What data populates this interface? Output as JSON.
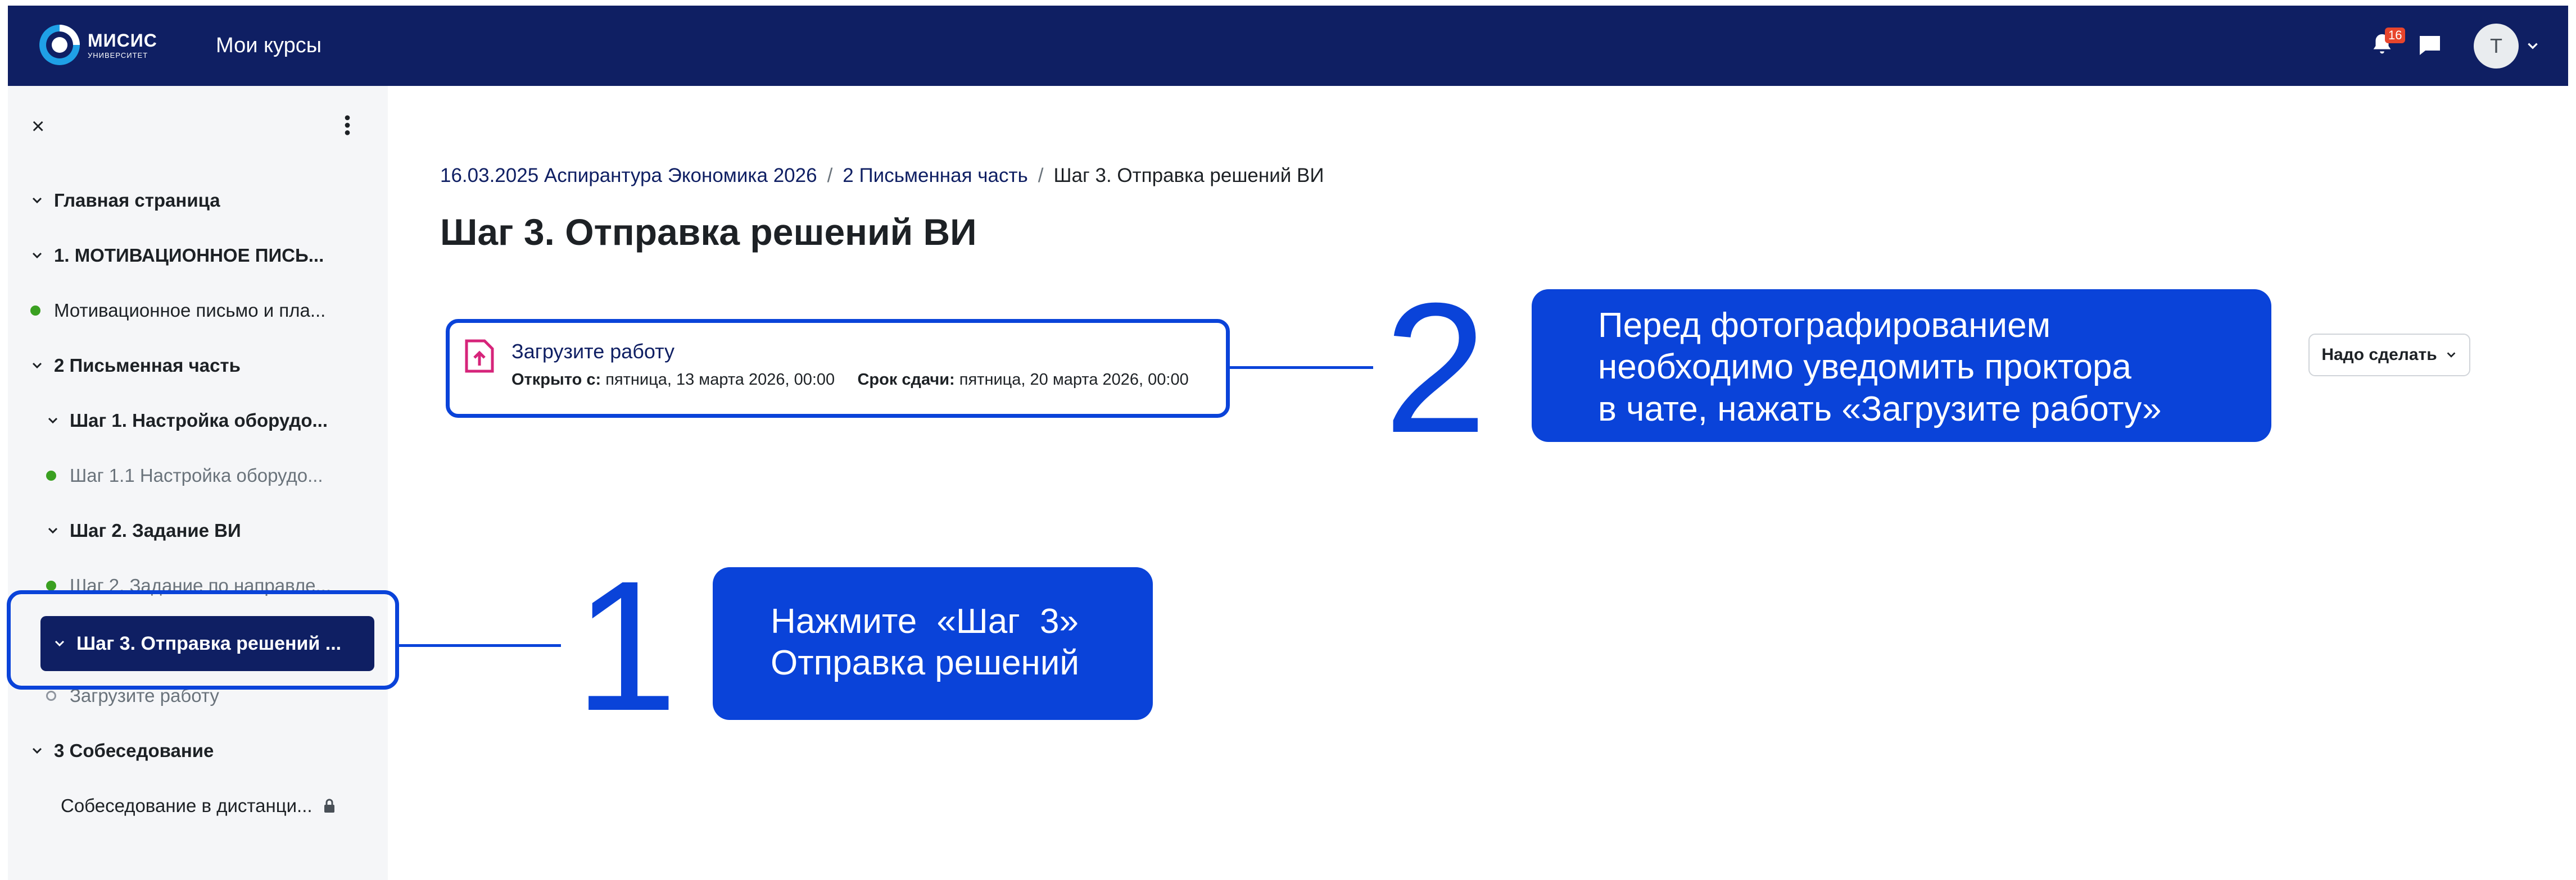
{
  "navbar": {
    "logo_name": "МИСИС",
    "logo_sub": "УНИВЕРСИТЕТ",
    "my_courses": "Мои курсы",
    "notification_count": "16",
    "avatar_initial": "Т"
  },
  "drawer": {
    "close": "×",
    "items": [
      {
        "label": "Главная страница"
      },
      {
        "label": "1. МОТИВАЦИОННОЕ ПИСЬ..."
      },
      {
        "label": "Мотивационное письмо и пла..."
      },
      {
        "label": "2 Письменная часть"
      },
      {
        "label": "Шаг 1. Настройка оборудо..."
      },
      {
        "label": "Шаг 1.1 Настройка оборудо..."
      },
      {
        "label": "Шаг 2. Задание ВИ"
      },
      {
        "label": "Шаг 2. Задание по направле..."
      },
      {
        "label": "Шаг 3. Отправка решений ..."
      },
      {
        "label": "Загрузите работу"
      },
      {
        "label": "3 Собеседование"
      },
      {
        "label": "Собеседование в дистанци..."
      }
    ]
  },
  "breadcrumb": {
    "items": [
      "16.03.2025 Аспирантура Экономика 2026",
      "2 Письменная часть",
      "Шаг 3. Отправка решений ВИ"
    ],
    "separator": "/"
  },
  "page_title": "Шаг 3. Отправка решений ВИ",
  "activity": {
    "title": "Загрузите работу",
    "open_label": "Открыто с:",
    "open_value": "пятница, 13 марта 2026, 00:00",
    "due_label": "Срок сдачи:",
    "due_value": "пятница, 20 марта 2026, 00:00"
  },
  "todo_button": "Надо сделать",
  "annotations": {
    "step1_number": "1",
    "step1_text_line1": "Нажмите «Шаг 3»",
    "step1_text_line2": "Отправка решений",
    "step2_number": "2",
    "step2_text_line1": "Перед фотографированием",
    "step2_text_line2": "необходимо уведомить проктора",
    "step2_text_line3": "в чате, нажать «Загрузите работу»"
  },
  "colors": {
    "navbar": "#0f1f63",
    "annotation_blue": "#0a43d9",
    "drawer_bg": "#f5f6f8",
    "complete_dot": "#3aa021"
  }
}
